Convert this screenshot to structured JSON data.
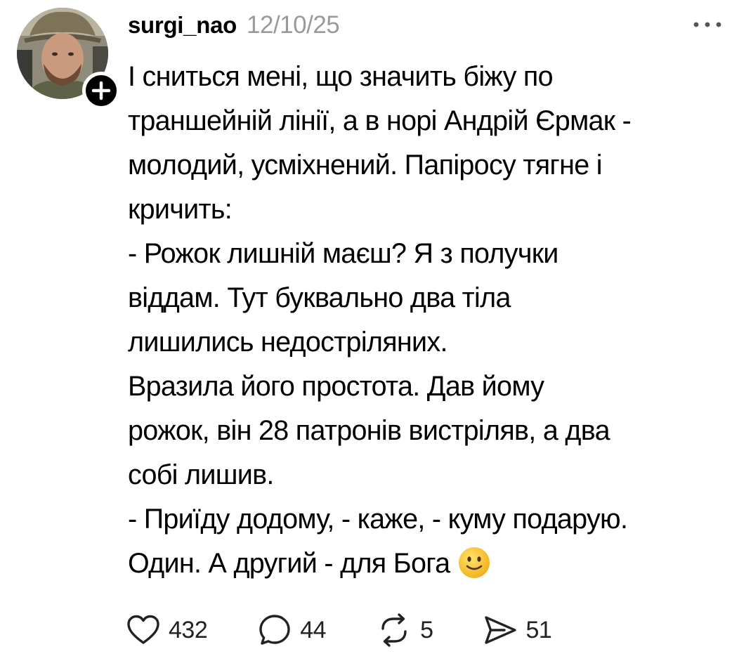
{
  "post": {
    "author": "surgi_nao",
    "date": "12/10/25",
    "body_lines": [
      "І сниться мені, що значить біжу по",
      "траншейній лінії, а в норі Андрій Єрмак -",
      "молодий, усміхнений. Папіросу тягне і",
      "кричить:",
      "- Рожок лишній маєш? Я з получки",
      "віддам. Тут буквально два тіла",
      "лишились недостріляних.",
      "Вразила його простота. Дав йому",
      "рожок, він 28 патронів вистріляв, а два",
      "собі лишив.",
      "- Приїду додому, - каже, - куму подарую.",
      "Один. А другий - для Бога"
    ],
    "emoji_icon": "slightly-smiling-face-icon"
  },
  "actions": {
    "likes": "432",
    "replies": "44",
    "reposts": "5",
    "shares": "51"
  },
  "icons": {
    "like": "heart-icon",
    "reply": "comment-bubble-icon",
    "repost": "repost-arrows-icon",
    "share": "send-icon",
    "more": "more-options-icon",
    "follow": "plus-icon"
  },
  "colors": {
    "text": "#000000",
    "muted": "#9a9a9a",
    "count": "#222222",
    "badge": "#000000",
    "emoji": "#f7c72f"
  }
}
